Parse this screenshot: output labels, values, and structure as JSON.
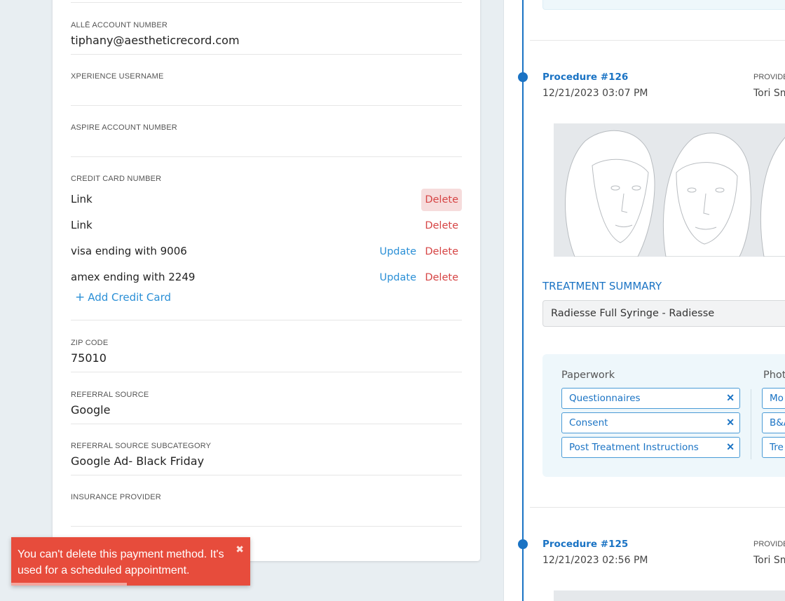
{
  "left": {
    "alle": {
      "label": "ALLĒ ACCOUNT NUMBER",
      "value": "tiphany@aestheticrecord.com"
    },
    "xperience": {
      "label": "XPERIENCE USERNAME",
      "value": ""
    },
    "aspire": {
      "label": "ASPIRE ACCOUNT NUMBER",
      "value": ""
    },
    "credit": {
      "label": "CREDIT CARD NUMBER",
      "cards": [
        {
          "text": "Link",
          "update": "",
          "delete": "Delete"
        },
        {
          "text": "Link",
          "update": "",
          "delete": "Delete"
        },
        {
          "text": "visa ending with 9006",
          "update": "Update",
          "delete": "Delete"
        },
        {
          "text": "amex ending with 2249",
          "update": "Update",
          "delete": "Delete"
        }
      ],
      "add_plus": "+",
      "add_label": "Add Credit Card"
    },
    "zip": {
      "label": "ZIP CODE",
      "value": "75010"
    },
    "referral": {
      "label": "REFERRAL SOURCE",
      "value": "Google"
    },
    "referral_sub": {
      "label": "REFERRAL SOURCE SUBCATEGORY",
      "value": "Google Ad- Black Friday"
    },
    "insurance": {
      "label": "INSURANCE PROVIDER",
      "value": ""
    }
  },
  "right": {
    "procedures": [
      {
        "title": "Procedure #126",
        "date": "12/21/2023 03:07 PM",
        "provider_label": "PROVIDE",
        "provider": "Tori Sm"
      },
      {
        "title": "Procedure #125",
        "date": "12/21/2023 02:56 PM",
        "provider_label": "PROVIDE",
        "provider": "Tori Sm"
      }
    ],
    "treatment_summary": "TREATMENT SUMMARY",
    "treatment_value": "Radiesse Full Syringe - Radiesse",
    "paperwork": {
      "heading": "Paperwork",
      "chips": [
        "Questionnaires",
        "Consent",
        "Post Treatment Instructions"
      ]
    },
    "photos": {
      "heading": "Phot",
      "chips": [
        "Mo",
        "B&A",
        "Tre"
      ]
    }
  },
  "toast": {
    "message": "You can't delete this payment method. It's used for a scheduled appointment.",
    "close_glyph": "✖"
  },
  "colors": {
    "accent": "#1a73c4",
    "danger": "#d64545",
    "toast": "#e74c3c"
  },
  "icons": {
    "remove_chip": "close-icon",
    "toast_close": "close-icon"
  }
}
